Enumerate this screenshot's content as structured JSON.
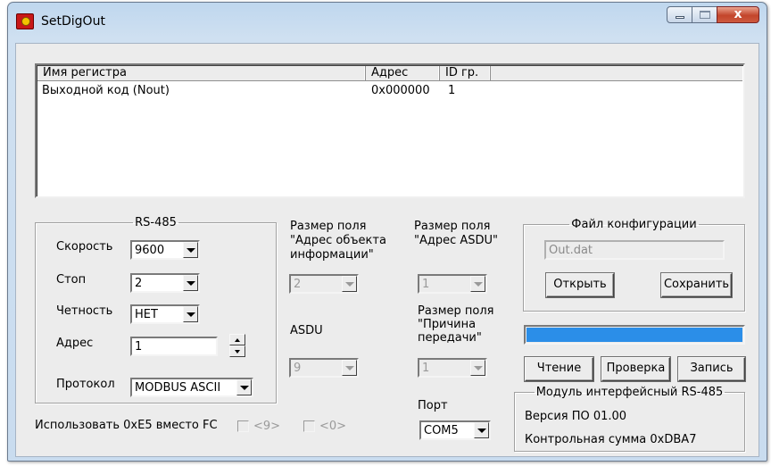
{
  "window": {
    "title": "SetDigOut",
    "close_label": "x"
  },
  "table": {
    "columns": [
      "Имя регистра",
      "Адрес",
      "ID гр."
    ],
    "rows": [
      {
        "name": "Выходной код (Nout)",
        "address": "0x000000",
        "id": "1"
      }
    ]
  },
  "rs485": {
    "legend": "RS-485",
    "speed_label": "Скорость",
    "speed_value": "9600",
    "stop_label": "Стоп",
    "stop_value": "2",
    "parity_label": "Четность",
    "parity_value": "НЕТ",
    "address_label": "Адрес",
    "address_value": "1",
    "protocol_label": "Протокол",
    "protocol_value": "MODBUS ASCII"
  },
  "ioa_size": {
    "label_line1": "Размер поля",
    "label_line2": "\"Адрес объекта",
    "label_line3": "информации\"",
    "value": "2"
  },
  "asdu_size": {
    "label_line1": "Размер поля",
    "label_line2": "\"Адрес ASDU\"",
    "value": "1"
  },
  "asdu": {
    "label": "ASDU",
    "value": "9"
  },
  "cot_size": {
    "label_line1": "Размер поля",
    "label_line2": "\"Причина",
    "label_line3": "передачи\"",
    "value": "1"
  },
  "port": {
    "label": "Порт",
    "value": "COM5"
  },
  "options": {
    "use_e5_label": "Использовать 0xE5 вместо FC",
    "chk1_label": "<9>",
    "chk2_label": "<0>"
  },
  "config": {
    "legend": "Файл конфигурации",
    "file": "Out.dat",
    "open_label": "Открыть",
    "save_label": "Сохранить"
  },
  "progress": {
    "value": 1.0,
    "color": "#2b8ee8"
  },
  "actions": {
    "read_label": "Чтение",
    "verify_label": "Проверка",
    "write_label": "Запись"
  },
  "module": {
    "legend": "Модуль интерфейсный RS-485",
    "version": "Версия ПО 01.00",
    "checksum": "Контрольная сумма 0xDBA7"
  }
}
